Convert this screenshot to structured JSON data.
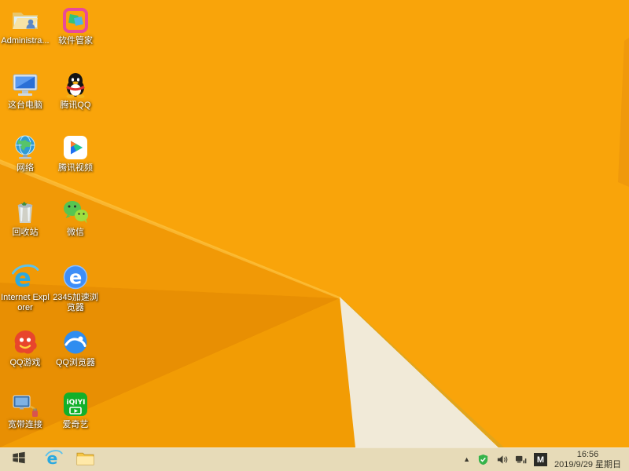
{
  "colors": {
    "wallpaper_base": "#F9A40A",
    "wallpaper_band_light": "#F19906",
    "wallpaper_band_dark": "#E88F03",
    "wallpaper_bottom_strip": "#F29C04",
    "wallpaper_cream": "#F1EAD8",
    "taskbar_bg": "#E7DBB8"
  },
  "desktop": {
    "columns": [
      {
        "items": [
          {
            "label": "Administra...",
            "icon": "user-folder-icon"
          },
          {
            "label": "这台电脑",
            "icon": "computer-icon"
          },
          {
            "label": "网络",
            "icon": "network-globe-icon"
          },
          {
            "label": "回收站",
            "icon": "recycle-bin-icon"
          },
          {
            "label": "Internet Explorer",
            "icon": "internet-explorer-icon"
          },
          {
            "label": "QQ游戏",
            "icon": "qq-games-icon"
          },
          {
            "label": "宽带连接",
            "icon": "broadband-icon"
          }
        ]
      },
      {
        "items": [
          {
            "label": "软件管家",
            "icon": "software-manager-icon"
          },
          {
            "label": "腾讯QQ",
            "icon": "qq-penguin-icon"
          },
          {
            "label": "腾讯视频",
            "icon": "tencent-video-icon"
          },
          {
            "label": "微信",
            "icon": "wechat-icon"
          },
          {
            "label": "2345加速浏览器",
            "icon": "2345-browser-icon"
          },
          {
            "label": "QQ浏览器",
            "icon": "qq-browser-icon"
          },
          {
            "label": "爱奇艺",
            "icon": "iqiyi-icon"
          }
        ]
      }
    ]
  },
  "taskbar": {
    "start_icon": "windows-start-icon",
    "pinned_icons": [
      "internet-explorer-icon",
      "file-explorer-icon"
    ],
    "tray": {
      "icons": [
        "hidden-icons-chevron",
        "security-green-icon",
        "volume-icon",
        "network-tray-icon"
      ],
      "ime_badge": "M",
      "time": "16:56",
      "date": "2019/9/29 星期日"
    }
  }
}
